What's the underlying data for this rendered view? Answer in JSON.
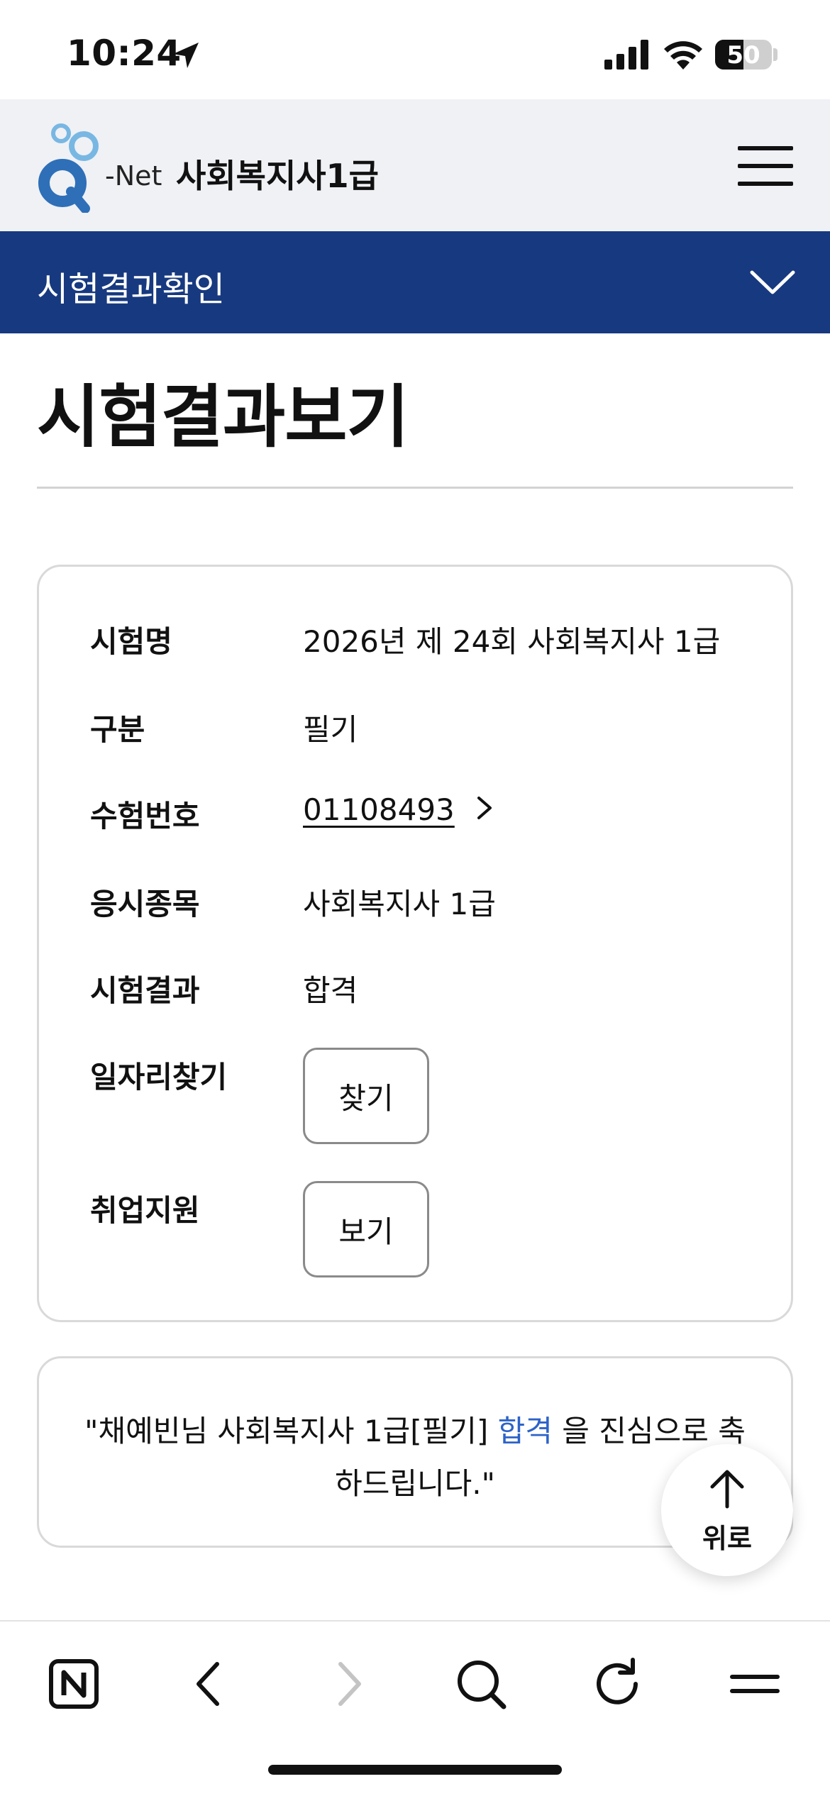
{
  "status_bar": {
    "time": "10:24",
    "battery": "50",
    "battery_level": 0.5
  },
  "header": {
    "logo_text": "-Net",
    "title": "사회복지사1급",
    "menu_icon": "hamburger-menu-icon"
  },
  "section_bar": {
    "label": "시험결과확인",
    "icon": "chevron-down-icon"
  },
  "page": {
    "title": "시험결과보기"
  },
  "info_card": {
    "rows": [
      {
        "label": "시험명",
        "value": "2026년 제 24회 사회복지사 1급"
      },
      {
        "label": "구분",
        "value": "필기"
      },
      {
        "label": "수험번호",
        "value": "01108493"
      },
      {
        "label": "응시종목",
        "value": "사회복지사 1급"
      },
      {
        "label": "시험결과",
        "value": "합격"
      },
      {
        "label": "일자리찾기",
        "button": "찾기"
      },
      {
        "label": "취업지원",
        "button": "보기"
      }
    ]
  },
  "congrats": {
    "prefix": "\"채예빈님 사회복지사 1급[필기] ",
    "highlight": "합격",
    "suffix": " 을 진심으로 축하드립니다.\"",
    "highlight_color": "#2d63c8"
  },
  "top_button": {
    "label": "위로",
    "icon": "arrow-up-icon"
  },
  "toolbar": {
    "icons": [
      "naver-home-icon",
      "back-icon",
      "forward-icon",
      "search-icon",
      "reload-icon",
      "menu-icon"
    ]
  },
  "colors": {
    "header_bg": "#eff1f5",
    "section_bar_bg": "#17397f",
    "logo_blue": "#2e6fb8",
    "logo_light_blue": "#79b7e3"
  }
}
